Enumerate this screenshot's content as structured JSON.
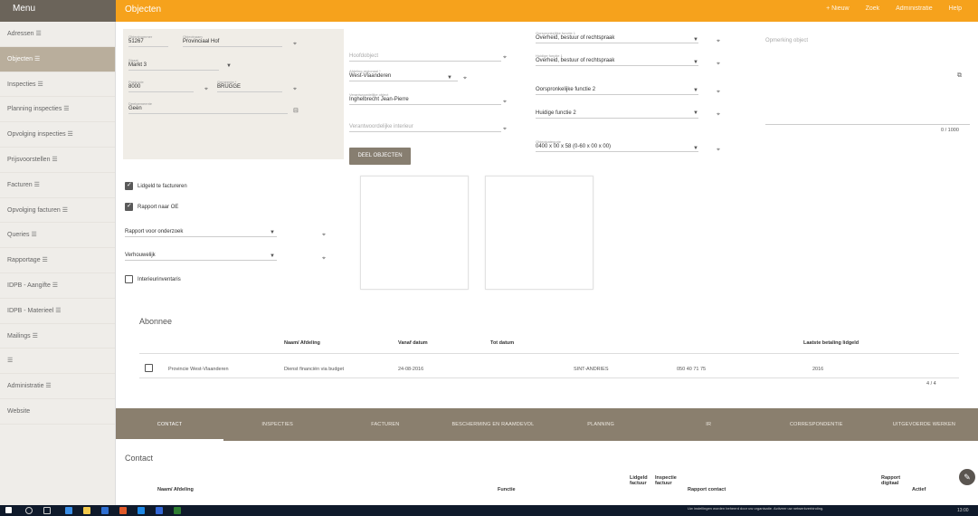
{
  "menu": {
    "title": "Menu"
  },
  "topbar": {
    "title": "Objecten",
    "actions": [
      "+ Nieuw",
      "Zoek",
      "Administratie",
      "Help"
    ]
  },
  "sidebar": {
    "items": [
      {
        "label": "Adressen ☰"
      },
      {
        "label": "Objecten ☰"
      },
      {
        "label": "Inspecties ☰"
      },
      {
        "label": "Planning inspecties ☰"
      },
      {
        "label": "Opvolging inspecties ☰"
      },
      {
        "label": "Prijsvoorstellen ☰"
      },
      {
        "label": "Facturen ☰"
      },
      {
        "label": "Opvolging facturen ☰"
      },
      {
        "label": "Queries ☰"
      },
      {
        "label": "Rapportage ☰"
      },
      {
        "label": "IDPB - Aangifte ☰"
      },
      {
        "label": "IDPB - Materieel ☰"
      },
      {
        "label": "Mailings ☰"
      },
      {
        "label": "☰"
      },
      {
        "label": "Administratie ☰"
      },
      {
        "label": "Website"
      }
    ]
  },
  "object_panel": {
    "objectnummer_label": "Objectnummer",
    "objectnummer": "51267",
    "objectnaam_label": "Objectnaam",
    "objectnaam": "Provinciaal Hof",
    "straat_label": "Straat",
    "straat": "Markt 3",
    "postcode_label": "Postcode",
    "postcode": "8000",
    "gemeente_label": "Gemeente *",
    "gemeente": "BRUGGE",
    "gemeente2_label": "Deelgemeente",
    "gemeente2": "Geen"
  },
  "middle_fields": {
    "hoofdobject_label": "Hoofdobject",
    "afdeling_label": "Afdeling regionaal *",
    "afdeling": "West-Vlaanderen",
    "verantwoordelijke_label": "Verantwoordelijke object",
    "verantwoordelijke": "Inghelbrecht Jean-Pierre",
    "verantw_interieur": "Verantwoordelijke interieur",
    "deel_button": "DEEL OBJECTEN"
  },
  "right_fields": {
    "oorspr_functie1_label": "Oorspronkelijke functie 1",
    "oorspr_functie1": "Overheid, bestuur of rechtspraak",
    "huidige_functie1_label": "Huidige functie 1",
    "huidige_functie1": "Overheid, bestuur of rechtspraak",
    "oorspr_functie2": "Oorspronkelijke functie 2",
    "huidige_functie2": "Huidige functie 2",
    "objectcategorie_label": "Objectcategorie",
    "objectcategorie": "0400 x 00 x 58 (0-60 x 00 x 00)",
    "opmerking_placeholder": "Opmerking object",
    "char_count": "0 / 1000"
  },
  "checkboxes": {
    "lidgeld": "Lidgeld te factureren",
    "rapport": "Rapport naar OE",
    "rapport_onderzoek": "Rapport voor onderzoek",
    "verhouwelijk": "Verhouwelijk",
    "interieur": "Interieurinventaris"
  },
  "abonnee": {
    "title": "Abonnee",
    "headers": [
      "Naam/ Afdeling",
      "Vanaf datum",
      "Tot datum",
      "Laatste betaling lidgeld"
    ],
    "row": {
      "naam": "Provincie West-Vlaanderen",
      "afdeling": "Dienst financiën via budget",
      "vanaf": "24-08-2016",
      "gemeente": "SINT-ANDRIES",
      "telefoon": "050 40 71 75",
      "betaling": "2016"
    },
    "pager": "4 / 4"
  },
  "tabs": [
    "CONTACT",
    "INSPECTIES",
    "FACTUREN",
    "BESCHERMING EN RAAMDEVOL",
    "PLANNING",
    "IR",
    "CORRESPONDENTIE",
    "UITGEVOERDE WERKEN"
  ],
  "contact": {
    "title": "Contact",
    "headers": [
      "Naam/ Afdeling",
      "Functie",
      "Lidgeld factuur",
      "Inspectie factuur",
      "Rapport contact",
      "Rapport digitaal",
      "Actief"
    ]
  },
  "fab_icon": "pencil-icon",
  "taskbar": {
    "notice": "Uw instellingen worden beheerd door uw organisatie. Activeer uw netwerkverbinding.",
    "time": "13:00"
  }
}
